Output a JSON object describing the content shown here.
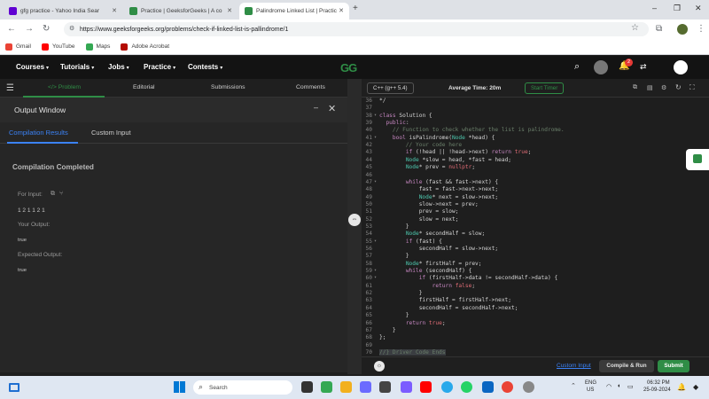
{
  "browser": {
    "tabs": [
      {
        "title": "gfg practice - Yahoo India Sear"
      },
      {
        "title": "Practice | GeeksforGeeks | A co"
      },
      {
        "title": "Palindrome Linked List | Practic"
      }
    ],
    "new_tab_label": "+",
    "url": "https://www.geeksforgeeks.org/problems/check-if-linked-list-is-pallindrome/1",
    "bookmarks": [
      {
        "label": "Gmail",
        "color": "#ea4335"
      },
      {
        "label": "YouTube",
        "color": "#ff0000"
      },
      {
        "label": "Maps",
        "color": "#34a853"
      },
      {
        "label": "Adobe Acrobat",
        "color": "#b30b00"
      }
    ]
  },
  "gfg_nav": {
    "items": [
      "Courses",
      "Tutorials",
      "Jobs",
      "Practice",
      "Contests"
    ],
    "logo": "GG",
    "notification_count": "2"
  },
  "problem_tabs": [
    "</> Problem",
    "Editorial",
    "Submissions",
    "Comments"
  ],
  "output_window": {
    "title": "Output Window",
    "tabs": [
      "Compilation Results",
      "Custom Input"
    ],
    "status": "Compilation Completed",
    "for_input_label": "For Input:",
    "input_value": "1 2 1 1 2 1",
    "your_output_label": "Your Output:",
    "your_output_value": "true",
    "expected_output_label": "Expected Output:",
    "expected_output_value": "true"
  },
  "editor_toolbar": {
    "language": "C++ (g++ 5.4)",
    "avg_time": "Average Time: 20m",
    "start_timer": "Start Timer"
  },
  "code_lines": [
    {
      "n": "36",
      "t": "*/"
    },
    {
      "n": "37",
      "t": ""
    },
    {
      "n": "38",
      "t": "class Solution {"
    },
    {
      "n": "39",
      "t": "  public:"
    },
    {
      "n": "40",
      "t": "    // Function to check whether the list is palindrome."
    },
    {
      "n": "41",
      "t": "    bool isPalindrome(Node *head) {"
    },
    {
      "n": "42",
      "t": "        // Your code here"
    },
    {
      "n": "43",
      "t": "        if (!head || !head->next) return true;"
    },
    {
      "n": "44",
      "t": "        Node *slow = head, *fast = head;"
    },
    {
      "n": "45",
      "t": "        Node* prev = nullptr;"
    },
    {
      "n": "46",
      "t": ""
    },
    {
      "n": "47",
      "t": "        while (fast && fast->next) {"
    },
    {
      "n": "48",
      "t": "            fast = fast->next->next;"
    },
    {
      "n": "49",
      "t": "            Node* next = slow->next;"
    },
    {
      "n": "50",
      "t": "            slow->next = prev;"
    },
    {
      "n": "51",
      "t": "            prev = slow;"
    },
    {
      "n": "52",
      "t": "            slow = next;"
    },
    {
      "n": "53",
      "t": "        }"
    },
    {
      "n": "54",
      "t": "        Node* secondHalf = slow;"
    },
    {
      "n": "55",
      "t": "        if (fast) {"
    },
    {
      "n": "56",
      "t": "            secondHalf = slow->next;"
    },
    {
      "n": "57",
      "t": "        }"
    },
    {
      "n": "58",
      "t": "        Node* firstHalf = prev;"
    },
    {
      "n": "59",
      "t": "        while (secondHalf) {"
    },
    {
      "n": "60",
      "t": "            if (firstHalf->data != secondHalf->data) {"
    },
    {
      "n": "61",
      "t": "                return false;"
    },
    {
      "n": "62",
      "t": "            }"
    },
    {
      "n": "63",
      "t": "            firstHalf = firstHalf->next;"
    },
    {
      "n": "64",
      "t": "            secondHalf = secondHalf->next;"
    },
    {
      "n": "65",
      "t": "        }"
    },
    {
      "n": "66",
      "t": "        return true;"
    },
    {
      "n": "67",
      "t": "    }"
    },
    {
      "n": "68",
      "t": "};"
    },
    {
      "n": "69",
      "t": ""
    },
    {
      "n": "70",
      "t": "//} Driver Code Ends"
    }
  ],
  "editor_footer": {
    "custom_input": "Custom Input",
    "compile_run": "Compile & Run",
    "submit": "Submit"
  },
  "taskbar": {
    "search_placeholder": "Search",
    "lang": "ENG",
    "region": "US",
    "time": "06:32 PM",
    "date": "25-09-2024"
  },
  "colors": {
    "gfg_green": "#2f8d46",
    "accent_blue": "#3b82f6"
  }
}
